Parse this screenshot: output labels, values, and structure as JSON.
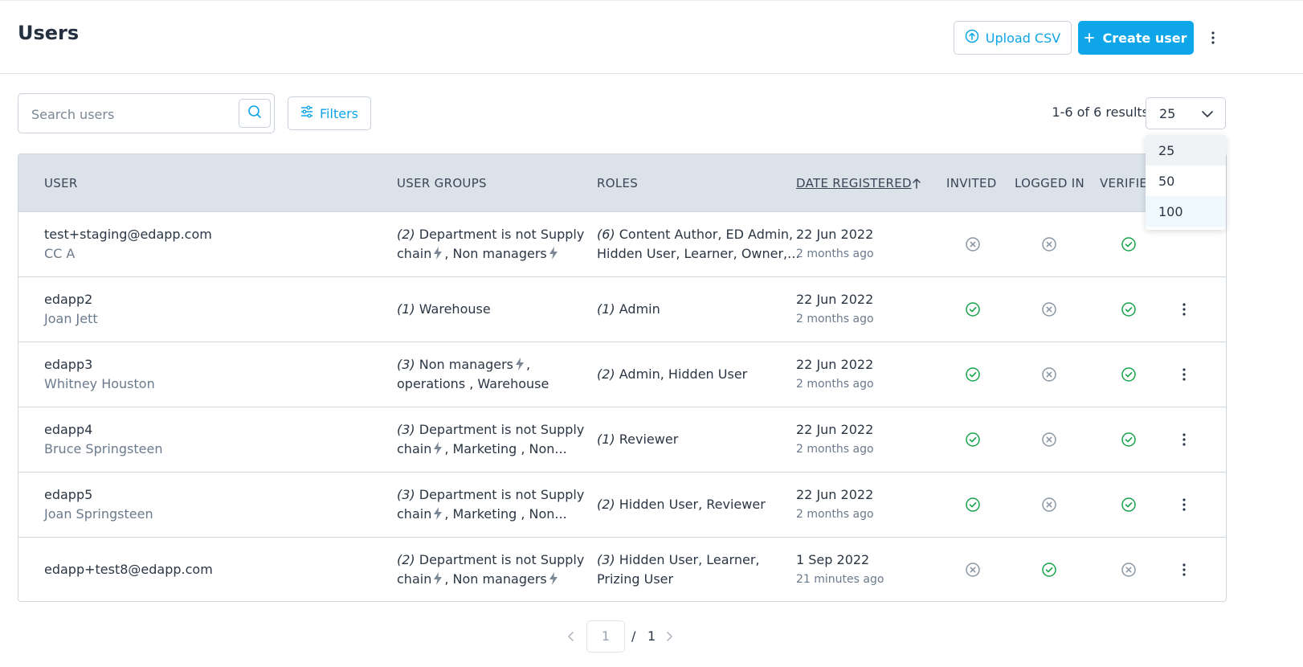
{
  "header": {
    "title": "Users",
    "upload_label": "Upload CSV",
    "create_label": "Create user"
  },
  "toolbar": {
    "search_placeholder": "Search users",
    "filters_label": "Filters",
    "results_text": "1-6 of 6 results",
    "page_size": "25",
    "page_size_options": [
      "25",
      "50",
      "100"
    ]
  },
  "table": {
    "columns": [
      "USER",
      "USER GROUPS",
      "ROLES",
      "DATE REGISTERED",
      "INVITED",
      "LOGGED IN",
      "VERIFIE"
    ],
    "rows": [
      {
        "user": "test+staging@edapp.com",
        "name": "CC A",
        "groups_count": "(2)",
        "groups_line1": " Department is not Supply",
        "groups_line2": "chain",
        "groups_line2b": ", Non managers",
        "roles_count": "(6)",
        "roles_line1": " Content Author, ED Admin,",
        "roles_line2": "Hidden User, Learner, Owner,...",
        "date": "22 Jun 2022",
        "ago": "2 months ago",
        "invited": false,
        "logged_in": false,
        "verified": true
      },
      {
        "user": "edapp2",
        "name": "Joan Jett",
        "groups_count": "(1)",
        "groups_line1": " Warehouse",
        "groups_line2": "",
        "groups_line2b": "",
        "roles_count": "(1)",
        "roles_line1": " Admin",
        "roles_line2": "",
        "date": "22 Jun 2022",
        "ago": "2 months ago",
        "invited": true,
        "logged_in": false,
        "verified": true
      },
      {
        "user": "edapp3",
        "name": "Whitney Houston",
        "groups_count": "(3)",
        "groups_line1": " Non managers",
        "groups_line2": "operations , Warehouse",
        "groups_line2b": "",
        "roles_count": "(2)",
        "roles_line1": " Admin, Hidden User",
        "roles_line2": "",
        "date": "22 Jun 2022",
        "ago": "2 months ago",
        "invited": true,
        "logged_in": false,
        "verified": true
      },
      {
        "user": "edapp4",
        "name": "Bruce Springsteen",
        "groups_count": "(3)",
        "groups_line1": " Department is not Supply",
        "groups_line2": "chain",
        "groups_line2b": ", Marketing , Non...",
        "roles_count": "(1)",
        "roles_line1": " Reviewer",
        "roles_line2": "",
        "date": "22 Jun 2022",
        "ago": "2 months ago",
        "invited": true,
        "logged_in": false,
        "verified": true
      },
      {
        "user": "edapp5",
        "name": "Joan Springsteen",
        "groups_count": "(3)",
        "groups_line1": " Department is not Supply",
        "groups_line2": "chain",
        "groups_line2b": ", Marketing , Non...",
        "roles_count": "(2)",
        "roles_line1": " Hidden User, Reviewer",
        "roles_line2": "",
        "date": "22 Jun 2022",
        "ago": "2 months ago",
        "invited": true,
        "logged_in": false,
        "verified": true
      },
      {
        "user": "edapp+test8@edapp.com",
        "name": "",
        "groups_count": "(2)",
        "groups_line1": " Department is not Supply",
        "groups_line2": "chain",
        "groups_line2b": ", Non managers",
        "roles_count": "(3)",
        "roles_line1": " Hidden User, Learner,",
        "roles_line2": "Prizing User",
        "date": "1 Sep 2022",
        "ago": "21 minutes ago",
        "invited": false,
        "logged_in": true,
        "verified": false
      }
    ]
  },
  "pagination": {
    "current": "1",
    "separator": "/",
    "total": "1"
  },
  "colors": {
    "accent": "#0ea5e9",
    "check": "#16a34a",
    "cross": "#8a96a3"
  }
}
